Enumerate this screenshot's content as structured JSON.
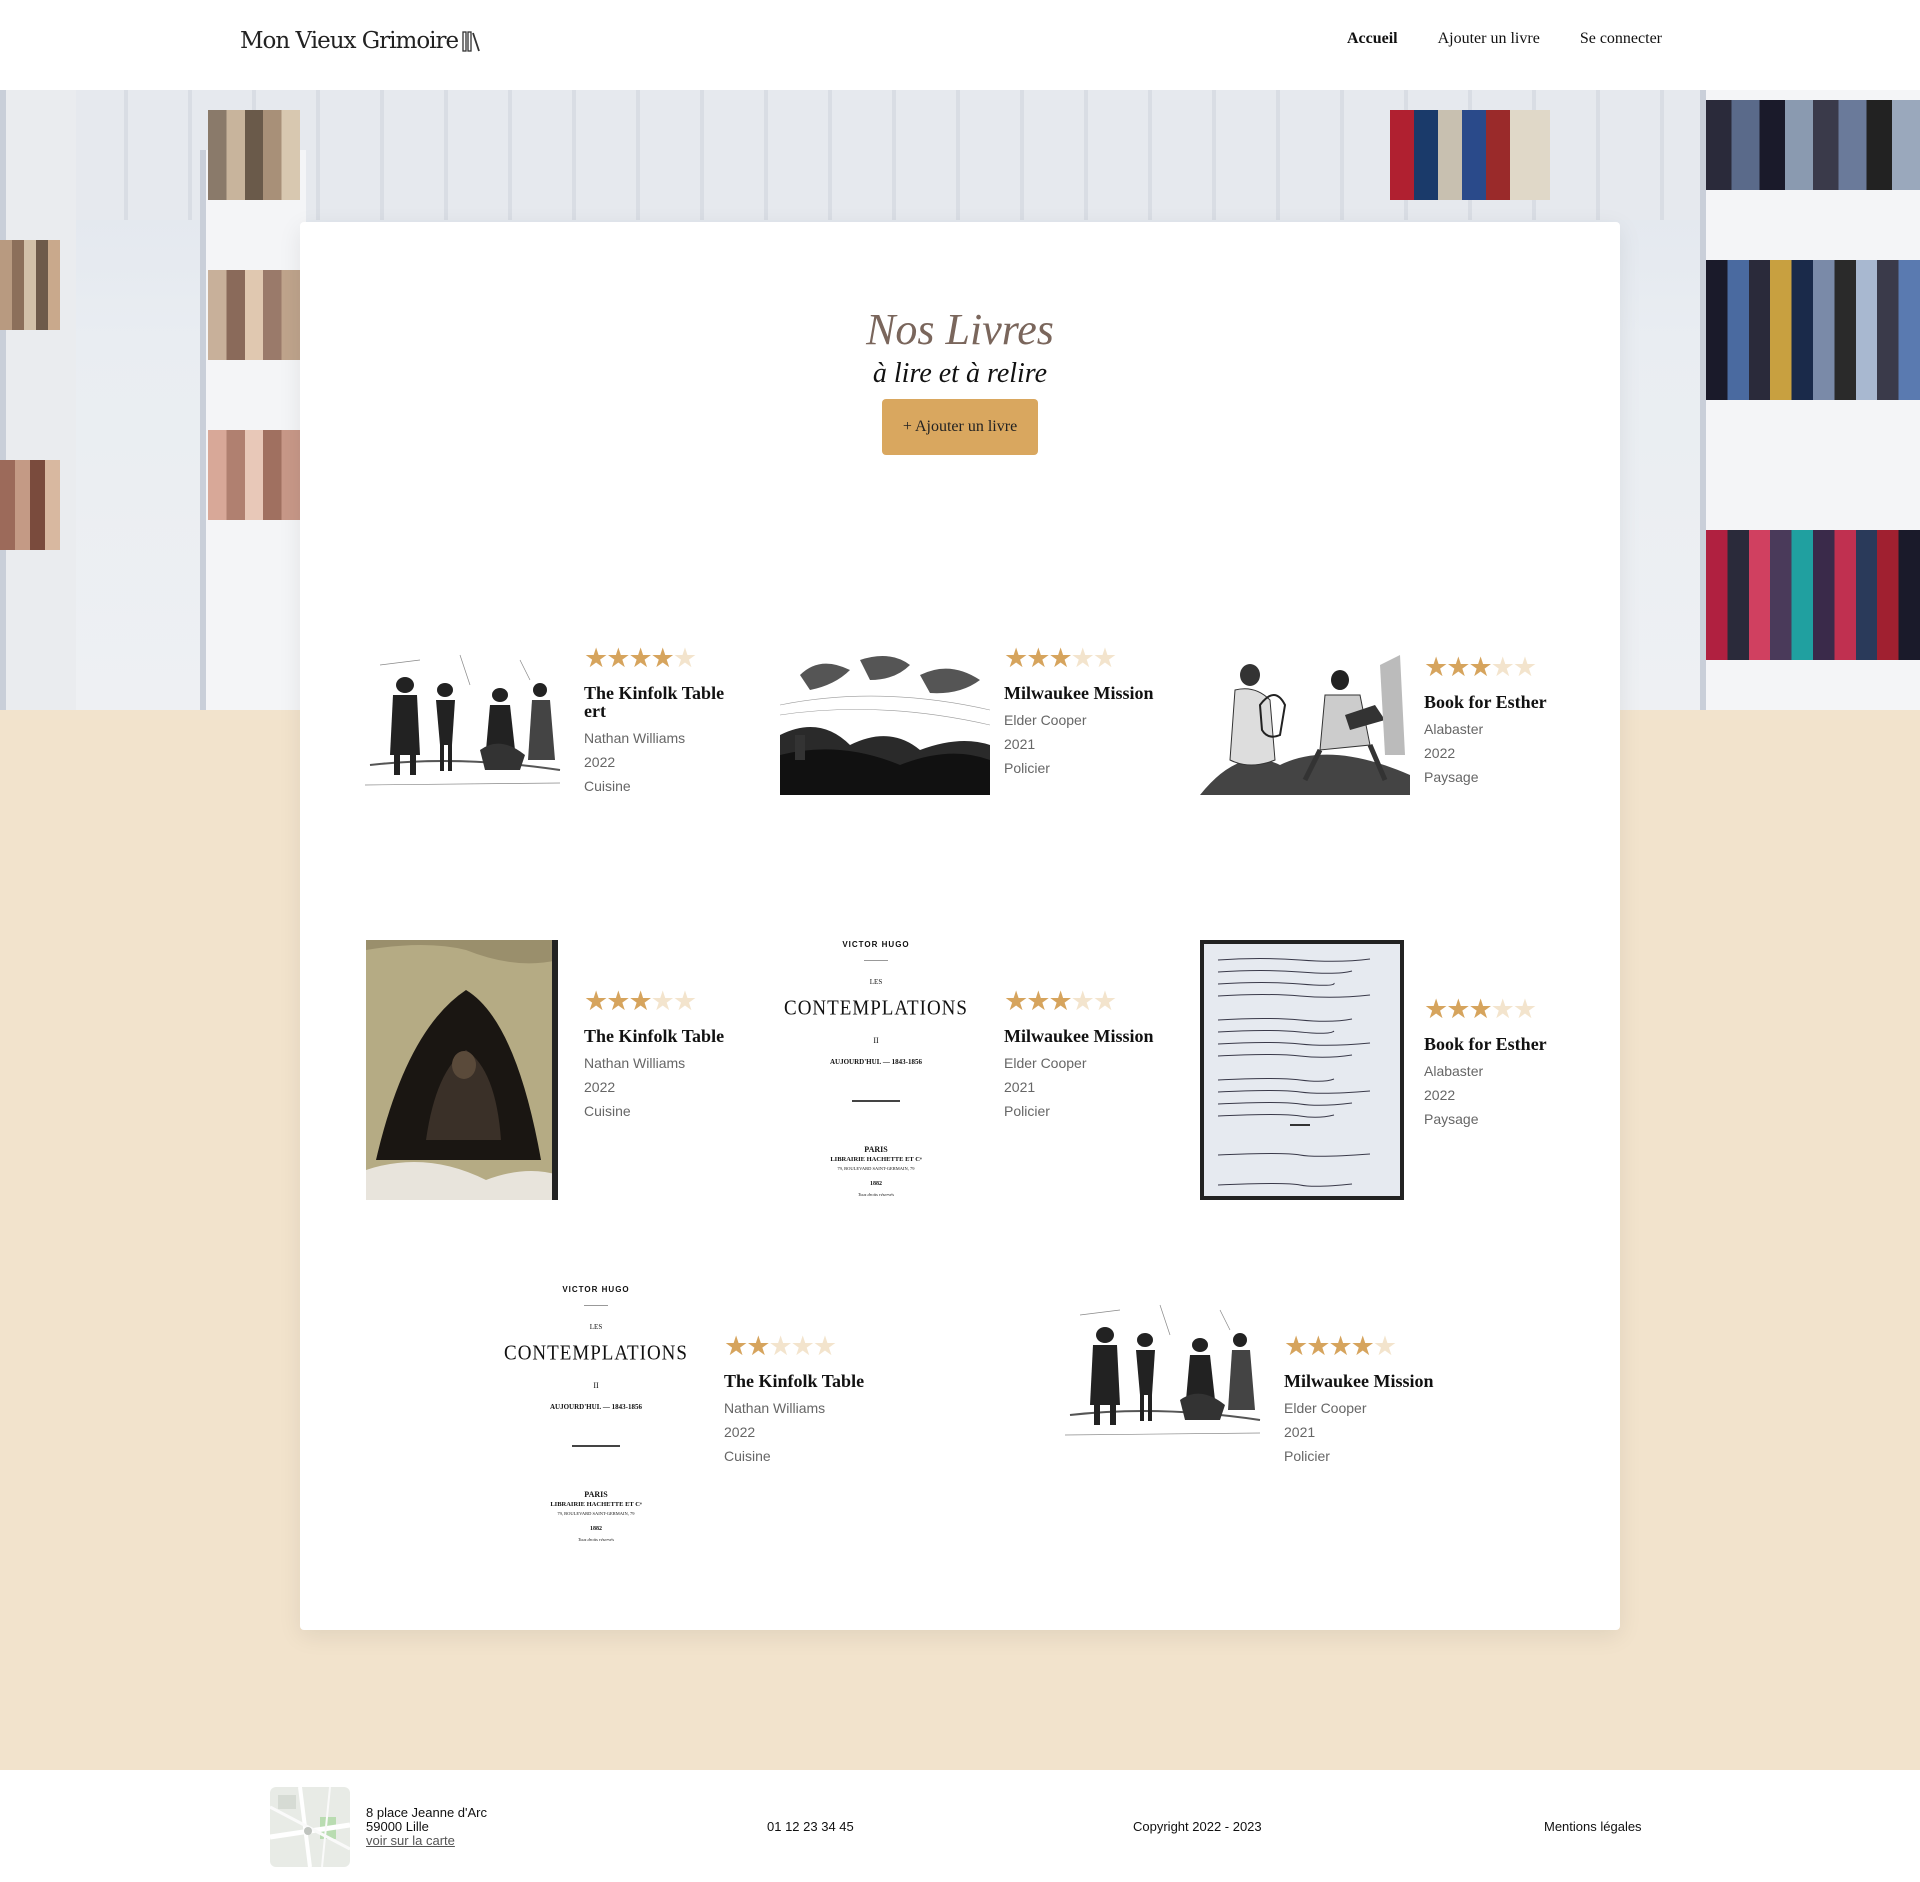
{
  "header": {
    "logo": "Mon Vieux Grimoire",
    "nav": [
      "Accueil",
      "Ajouter un livre",
      "Se connecter"
    ]
  },
  "hero": {
    "title": "Nos Livres",
    "subtitle": "à lire et à relire",
    "add_button": "+ Ajouter un livre"
  },
  "books": [
    {
      "title": "The Kinfolk Table ert",
      "author": "Nathan Williams",
      "year": "2022",
      "genre": "Cuisine",
      "rating": 4,
      "cover": "engraving-musicians"
    },
    {
      "title": "Milwaukee Mission",
      "author": "Elder Cooper",
      "year": "2021",
      "genre": "Policier",
      "rating": 3,
      "cover": "engraving-angels"
    },
    {
      "title": "Book for Esther",
      "author": "Alabaster",
      "year": "2022",
      "genre": "Paysage",
      "rating": 3,
      "cover": "engraving-lyre"
    },
    {
      "title": "The Kinfolk Table",
      "author": "Nathan Williams",
      "year": "2022",
      "genre": "Cuisine",
      "rating": 3,
      "cover": "sepia-cave-drawing"
    },
    {
      "title": "Milwaukee Mission",
      "author": "Elder Cooper",
      "year": "2021",
      "genre": "Policier",
      "rating": 3,
      "cover": "contemplations-title-page"
    },
    {
      "title": "Book for Esther",
      "author": "Alabaster",
      "year": "2022",
      "genre": "Paysage",
      "rating": 3,
      "cover": "handwritten-manuscript"
    },
    {
      "title": "The Kinfolk Table",
      "author": "Nathan Williams",
      "year": "2022",
      "genre": "Cuisine",
      "rating": 2,
      "cover": "contemplations-title-page"
    },
    {
      "title": "Milwaukee Mission",
      "author": "Elder Cooper",
      "year": "2021",
      "genre": "Policier",
      "rating": 4,
      "cover": "engraving-musicians"
    }
  ],
  "title_page": {
    "author": "VICTOR HUGO",
    "les": "LES",
    "title": "CONTEMPLATIONS",
    "volume": "II",
    "subtitle": "AUJOURD'HUI. — 1843-1856",
    "city": "PARIS",
    "publisher": "LIBRAIRIE HACHETTE ET Cᵉ",
    "address": "79, BOULEVARD SAINT-GERMAIN, 79",
    "year": "1882",
    "rights": "Tous droits réservés"
  },
  "footer": {
    "address_line1": "8 place Jeanne d'Arc",
    "address_line2": "59000 Lille",
    "map_link": "voir sur la carte",
    "phone": "01 12 23 34 45",
    "copyright": "Copyright 2022 - 2023",
    "legal": "Mentions légales"
  },
  "colors": {
    "accent": "#d9a75f",
    "star_on": "#d6a45d",
    "star_off": "#f3e4cd",
    "page_bg": "#f2e3cc",
    "title": "#7a665c"
  }
}
